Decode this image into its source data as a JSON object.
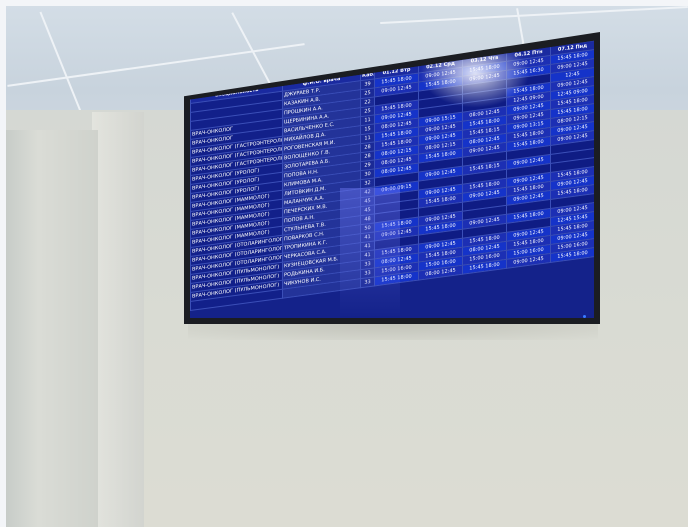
{
  "board": {
    "header": {
      "specialty": "Специальность",
      "doctor": "ф.И.О. врача",
      "cabinet": "Каб.",
      "days": [
        {
          "date": "01.12",
          "day": "Втр"
        },
        {
          "date": "02.12",
          "day": "Срд"
        },
        {
          "date": "03.12",
          "day": "Чтв"
        },
        {
          "date": "04.12",
          "day": "Птн"
        },
        {
          "date": "07.12",
          "day": "Пнд"
        }
      ]
    },
    "rows": [
      {
        "spec": "",
        "doc": "ДЖУРАЕВ Т.Р.",
        "cab": "39",
        "slots": [
          "15:45 18:00",
          "09:00 12:45",
          "15:45 18:00",
          "09:00 12:45",
          "15:45 18:00"
        ]
      },
      {
        "spec": "",
        "doc": "КАЗАКИН А.В.",
        "cab": "25",
        "slots": [
          "09:00 12:45",
          "15:45 18:00",
          "09:00 12:45",
          "15:45 16:30",
          "09:00 12:45"
        ]
      },
      {
        "spec": "",
        "doc": "ПРОШКИН А.А.",
        "cab": "22",
        "slots": [
          "",
          "",
          "",
          "",
          "12:45"
        ]
      },
      {
        "spec": "ВРАЧ-ОНКОЛОГ",
        "doc": "ЩЕРБИНИНА А.А.",
        "cab": "25",
        "slots": [
          "15:45 18:00",
          "",
          "",
          "15:45 18:00",
          "09:00 12:45"
        ]
      },
      {
        "spec": "ВРАЧ-ОНКОЛОГ",
        "doc": "ВАСИЛЬЧЕНКО Е.С.",
        "cab": "11",
        "slots": [
          "09:00 12:45",
          "",
          "",
          "12:45 09:00",
          "12:45 09:00"
        ]
      },
      {
        "spec": "ВРАЧ-ОНКОЛОГ (ГАСТРОЭНТЕРОЛОГ)",
        "doc": "МИХАЙЛОВ Д.А.",
        "cab": "15",
        "slots": [
          "08:00 12:45",
          "09:00 15:15",
          "08:00 12:45",
          "09:00 12:45",
          "15:45 18:00"
        ]
      },
      {
        "spec": "ВРАЧ-ОНКОЛОГ (ГАСТРОЭНТЕРОЛОГ)",
        "doc": "РОГОВЕНСКАЯ М.И.",
        "cab": "11",
        "slots": [
          "15:45 18:00",
          "09:00 12:45",
          "15:45 18:00",
          "09:00 12:45",
          "15:45 18:00"
        ]
      },
      {
        "spec": "ВРАЧ-ОНКОЛОГ (ГАСТРОЭНТЕРОЛОГ)",
        "doc": "ВОЛОЩЕНКО Г.В.",
        "cab": "28",
        "slots": [
          "15:45 18:00",
          "09:00 12:45",
          "15:45 18:15",
          "09:00 13:15",
          "08:00 12:15"
        ]
      },
      {
        "spec": "ВРАЧ-ОНКОЛОГ (УРОЛОГ)",
        "doc": "ЗОЛОТАРЕВА А.Б.",
        "cab": "28",
        "slots": [
          "08:00 12:15",
          "08:00 12:15",
          "08:00 12:45",
          "15:45 18:00",
          "09:00 12:45"
        ]
      },
      {
        "spec": "ВРАЧ-ОНКОЛОГ (УРОЛОГ)",
        "doc": "ПОПОВА Н.Н.",
        "cab": "29",
        "slots": [
          "08:00 12:45",
          "15:45 18:00",
          "09:00 12:45",
          "15:45 18:00",
          "09:00 12:45"
        ]
      },
      {
        "spec": "ВРАЧ-ОНКОЛОГ (УРОЛОГ)",
        "doc": "КЛИМОВА М.А.",
        "cab": "30",
        "slots": [
          "08:00 12:45",
          "",
          "",
          "",
          ""
        ]
      },
      {
        "spec": "ВРАЧ-ОНКОЛОГ (МАММОЛОГ)",
        "doc": "ЛИТОВКИН Д.М.",
        "cab": "32",
        "slots": [
          "",
          "09:00 12:45",
          "15:45 18:15",
          "09:00 12:45",
          ""
        ]
      },
      {
        "spec": "ВРАЧ-ОНКОЛОГ (МАММОЛОГ)",
        "doc": "МАЛАНЧУК А.А.",
        "cab": "42",
        "slots": [
          "09:00 09:15",
          "",
          "",
          "",
          ""
        ]
      },
      {
        "spec": "ВРАЧ-ОНКОЛОГ (МАММОЛОГ)",
        "doc": "ПЕЧЕРСКИХ М.В.",
        "cab": "45",
        "slots": [
          "",
          "09:00 12:45",
          "15:45 18:00",
          "09:00 12:45",
          "15:45 18:00"
        ]
      },
      {
        "spec": "ВРАЧ-ОНКОЛОГ (МАММОЛОГ)",
        "doc": "ПОПОВ А.Н.",
        "cab": "45",
        "slots": [
          "",
          "15:45 18:00",
          "09:00 12:45",
          "15:45 18:00",
          "09:00 12:45"
        ]
      },
      {
        "spec": "ВРАЧ-ОНКОЛОГ (МАММОЛОГ)",
        "doc": "СТУЛЬНЕВА Т.В.",
        "cab": "48",
        "slots": [
          "",
          "",
          "",
          "09:00 12:45",
          "15:45 18:00"
        ]
      },
      {
        "spec": "ВРАЧ-ОНКОЛОГ (ОТОЛАРИНГОЛОГ)",
        "doc": "ПОВАРКОВ С.Н.",
        "cab": "50",
        "slots": [
          "15:45 18:00",
          "09:00 12:45",
          "",
          "",
          ""
        ]
      },
      {
        "spec": "ВРАЧ-ОНКОЛОГ (ОТОЛАРИНГОЛОГ)",
        "doc": "ТРОПИКИНА К.Г.",
        "cab": "41",
        "slots": [
          "09:00 12:45",
          "15:45 18:00",
          "09:00 12:45",
          "15:45 18:00",
          "09:00 12:45"
        ]
      },
      {
        "spec": "ВРАЧ-ОНКОЛОГ (ОТОЛАРИНГОЛОГ)",
        "doc": "ЧЕРКАСОВА С.А.",
        "cab": "41",
        "slots": [
          "",
          "",
          "",
          "",
          "12:45 15:45"
        ]
      },
      {
        "spec": "ВРАЧ-ОНКОЛОГ (ПУЛЬМОНОЛОГ)",
        "doc": "КУЗНЕЦОВСКАЯ М.Б.",
        "cab": "41",
        "slots": [
          "15:45 18:00",
          "09:00 12:45",
          "15:45 18:00",
          "09:00 12:45",
          "15:45 18:00"
        ]
      },
      {
        "spec": "ВРАЧ-ОНКОЛОГ (ПУЛЬМОНОЛОГ)",
        "doc": "РОДЬКИНА И.Б.",
        "cab": "33",
        "slots": [
          "08:00 12:45",
          "15:45 18:00",
          "08:00 12:45",
          "15:45 18:00",
          "09:00 12:45"
        ]
      },
      {
        "spec": "ВРАЧ-ОНКОЛОГ (ПУЛЬМОНОЛОГ)",
        "doc": "ЧИКУНОВ И.С.",
        "cab": "33",
        "slots": [
          "15:00 16:00",
          "15:00 16:00",
          "15:00 16:00",
          "15:00 16:00",
          "15:00 16:00"
        ]
      },
      {
        "spec": "",
        "doc": "",
        "cab": "33",
        "slots": [
          "15:45 18:00",
          "08:00 12:45",
          "15:45 18:00",
          "09:00 12:45",
          "15:45 18:00"
        ]
      }
    ]
  }
}
